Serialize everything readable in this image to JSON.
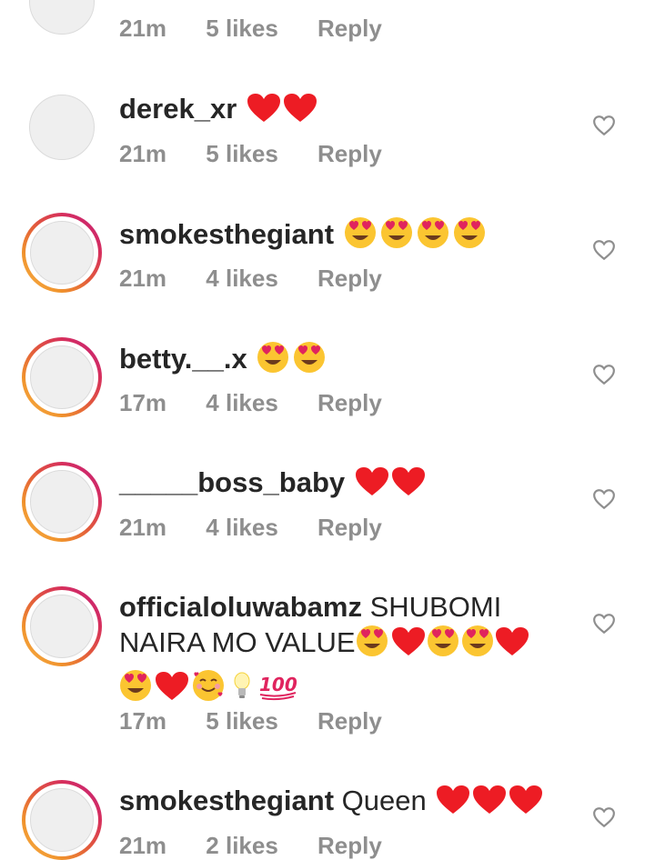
{
  "top_meta": {
    "time": "21m",
    "likes": "5 likes",
    "reply": "Reply"
  },
  "comments": [
    {
      "username": "derek_xr",
      "text": "",
      "emojis": "❤️❤️",
      "time": "21m",
      "likes": "5 likes",
      "reply": "Reply",
      "has_story": false
    },
    {
      "username": "smokesthegiant",
      "text": "",
      "emojis": "😍😍😍😍",
      "time": "21m",
      "likes": "4 likes",
      "reply": "Reply",
      "has_story": true
    },
    {
      "username": "betty.__.x",
      "text": "",
      "emojis": "😍😍",
      "time": "17m",
      "likes": "4 likes",
      "reply": "Reply",
      "has_story": true
    },
    {
      "username": "_____boss_baby",
      "text": "",
      "emojis": "❤️❤️",
      "time": "21m",
      "likes": "4 likes",
      "reply": "Reply",
      "has_story": true
    },
    {
      "username": "officialoluwabamz",
      "text": "SHUBOMI NAIRA MO VALUE",
      "emojis": "😍❤️😍😍❤️😍❤️🥰💡💯",
      "time": "17m",
      "likes": "5 likes",
      "reply": "Reply",
      "has_story": true
    },
    {
      "username": "smokesthegiant",
      "text": "Queen",
      "emojis": "❤️❤️❤️",
      "time": "21m",
      "likes": "2 likes",
      "reply": "Reply",
      "has_story": true
    }
  ],
  "icons": {
    "like": "heart-outline-icon"
  },
  "colors": {
    "text": "#262626",
    "meta": "#8e8e8e",
    "heart_red": "#ed1c24",
    "story_ring": "#d62e5d"
  }
}
